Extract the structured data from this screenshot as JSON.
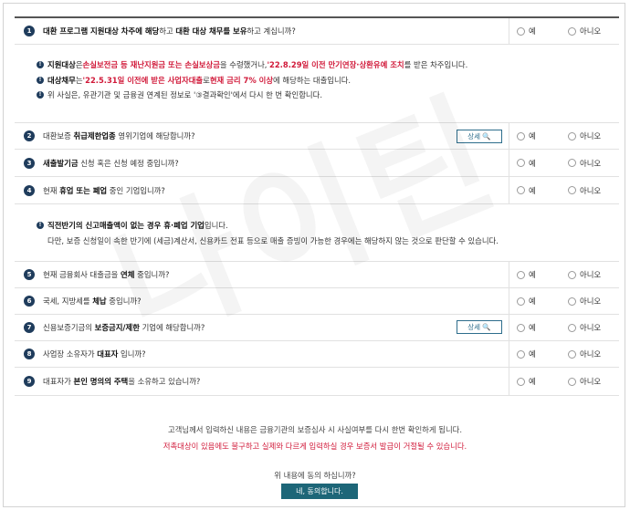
{
  "questions": [
    {
      "num": "1",
      "pre": "",
      "b1": "대환 프로그램 지원대상 차주에 해당",
      "mid": "하고 ",
      "b2": "대환 대상 채무를 보유",
      "post": "하고 계십니까?"
    },
    {
      "num": "2",
      "pre": "대환보증 ",
      "b1": "취급제한업종",
      "mid": " 영위기업에 해당합니까?",
      "b2": "",
      "post": ""
    },
    {
      "num": "3",
      "pre": "",
      "b1": "새출발기금",
      "mid": " 신청 혹은 신청 예정 중입니까?",
      "b2": "",
      "post": ""
    },
    {
      "num": "4",
      "pre": "현재 ",
      "b1": "휴업 또는 폐업",
      "mid": " 중인 기업입니까?",
      "b2": "",
      "post": ""
    },
    {
      "num": "5",
      "pre": "현재 금융회사 대출금을 ",
      "b1": "연체",
      "mid": " 중입니까?",
      "b2": "",
      "post": ""
    },
    {
      "num": "6",
      "pre": "국세, 지방세를 ",
      "b1": "체납",
      "mid": " 중입니까?",
      "b2": "",
      "post": ""
    },
    {
      "num": "7",
      "pre": "신용보증기금의 ",
      "b1": "보증금지/제한",
      "mid": " 기업에 해당합니까?",
      "b2": "",
      "post": ""
    },
    {
      "num": "8",
      "pre": "사업장 소유자가 ",
      "b1": "대표자",
      "mid": " 입니까?",
      "b2": "",
      "post": ""
    },
    {
      "num": "9",
      "pre": "대표자가 ",
      "b1": "본인 명의의 주택",
      "mid": "을 소유하고 있습니까?",
      "b2": "",
      "post": ""
    }
  ],
  "answers": {
    "yes": "예",
    "no": "아니오"
  },
  "detail_label": "상세 🔍",
  "note1": {
    "l1_b": "지원대상",
    "l1_a": "은 ",
    "l1_r1": "손실보전금 등 재난지원금 또는 손실보상금",
    "l1_c": "을 수령했거나, ",
    "l1_r2": "'22.8.29일 이전 만기연장·상환유예 조치",
    "l1_d": "를 받은 차주입니다.",
    "l2_b": "대상채무",
    "l2_a": "는 ",
    "l2_r1": "'22.5.31일 이전에 받은 사업자대출",
    "l2_c": "로 ",
    "l2_r2": "현재 금리 7% 이상",
    "l2_d": "에 해당하는 대출입니다.",
    "l3": "위 사실은, 유관기관 및 금융권 연계된 정보로 '③결과확인'에서 다시 한 번 확인합니다."
  },
  "note2": {
    "l1_b": "직전반기의 신고매출액이 없는 경우 휴·폐업 기업",
    "l1_a": "입니다.",
    "l2": "다만, 보증 신청일이 속한 반기에 (세금)계산서, 신용카드 전표 등으로 매출 증빙이 가능한 경우에는 해당하지 않는 것으로 판단할 수 있습니다."
  },
  "footer": {
    "line1": "고객님께서 입력하신 내용은 금융기관의 보증심사 시 사실여부를 다시 한번 확인하게 됩니다.",
    "line2": "저촉대상이 있음에도 불구하고 실제와 다르게 입력하실 경우 보증서 발급이 거절될 수 있습니다.",
    "question": "위 내용에 동의 하십니까?",
    "agree_label": "네, 동의합니다."
  },
  "watermark": "나이틴"
}
